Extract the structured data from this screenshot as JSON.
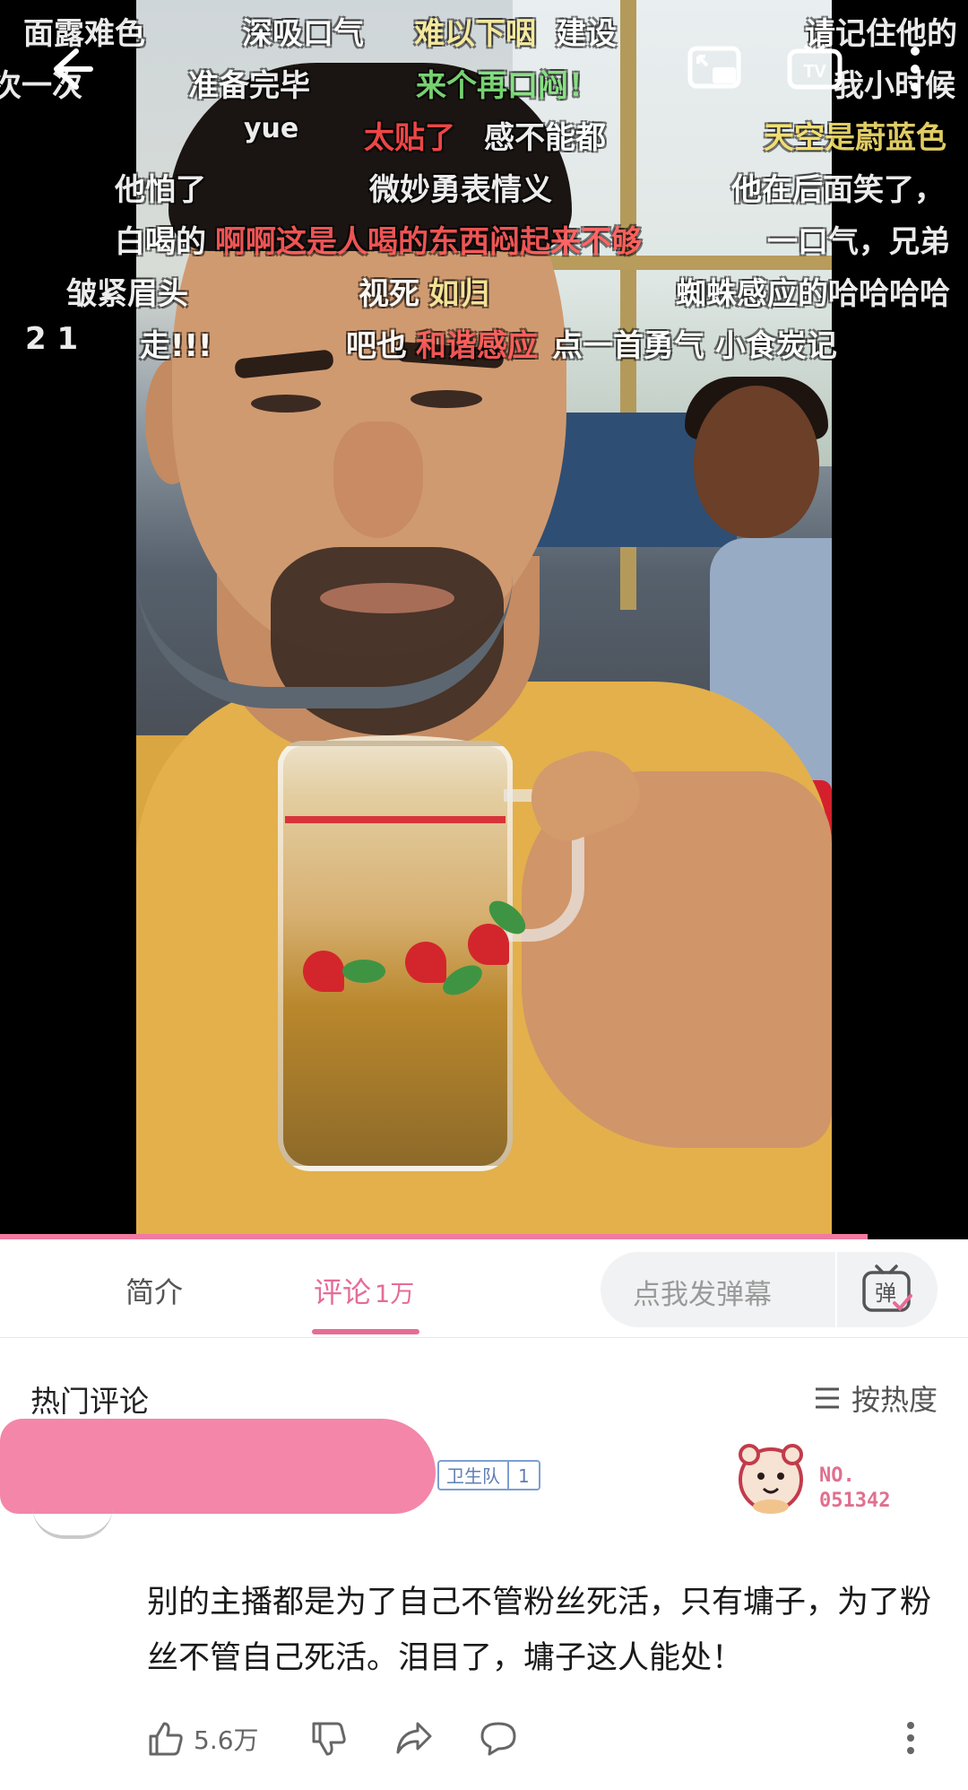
{
  "video": {
    "danmaku": [
      {
        "text": "面露难色",
        "color": "#ffffff"
      },
      {
        "text": "深吸口气",
        "color": "#ffffff"
      },
      {
        "text": "难以下咽",
        "color": "#f6e99a"
      },
      {
        "text": "建设",
        "color": "#ffffff"
      },
      {
        "text": "请记住他的",
        "color": "#ffffff"
      },
      {
        "text": "次一次",
        "color": "#ffffff"
      },
      {
        "text": "准备完毕",
        "color": "#ffffff"
      },
      {
        "text": "来个再口闷！",
        "color": "#7fe07a"
      },
      {
        "text": "我小时候",
        "color": "#ffffff"
      },
      {
        "text": "yue",
        "color": "#ffffff"
      },
      {
        "text": "太贴了",
        "color": "#ff4b4b"
      },
      {
        "text": "感不能都",
        "color": "#ffffff"
      },
      {
        "text": "天空是蔚蓝色",
        "color": "#f3de6b"
      },
      {
        "text": "他怕了",
        "color": "#ffffff"
      },
      {
        "text": "微妙勇表情义",
        "color": "#ffffff"
      },
      {
        "text": "他在后面笑了，",
        "color": "#ffffff"
      },
      {
        "text": "白喝的",
        "color": "#ffffff"
      },
      {
        "text": "啊啊这是人喝的东西闷起来不够",
        "color": "#ff5a5a"
      },
      {
        "text": "一口气，兄弟",
        "color": "#ffffff"
      },
      {
        "text": "皱紧眉头",
        "color": "#ffffff"
      },
      {
        "text": "视死",
        "color": "#ffffff"
      },
      {
        "text": "如归",
        "color": "#f6e99a"
      },
      {
        "text": "蜘蛛感应的哈哈哈哈",
        "color": "#ffffff"
      },
      {
        "text": "2  1",
        "color": "#ffffff"
      },
      {
        "text": "走!!!",
        "color": "#ffffff"
      },
      {
        "text": "吧也",
        "color": "#ffffff"
      },
      {
        "text": "和谐感应",
        "color": "#ff5a5a"
      },
      {
        "text": "点一首勇气 小食炭记",
        "color": "#ffffff"
      }
    ],
    "icons": [
      "back-arrow-icon",
      "pip-icon",
      "tv-cast-icon",
      "more-vertical-icon"
    ],
    "cast_label": "TV"
  },
  "tabs": {
    "intro": "简介",
    "comments": "评论",
    "comments_count": "1万",
    "danmaku_placeholder": "点我发弹幕",
    "danmaku_button": "弹",
    "accent": "#e56c97"
  },
  "comments": {
    "section_title": "热门评论",
    "sort_label": "按热度",
    "first": {
      "username_hidden": "",
      "tag_label": "卫生队",
      "tag_level": "1",
      "fan_no_label": "NO.",
      "fan_no_value": "051342",
      "text": "别的主播都是为了自己不管粉丝死活，只有墉子，为了粉丝不管自己死活。泪目了，墉子这人能处！",
      "likes": "5.6万"
    }
  }
}
